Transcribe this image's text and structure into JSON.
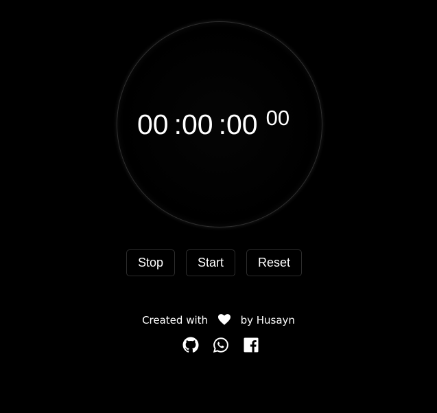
{
  "stopwatch": {
    "hours": "00",
    "minutes": ":00",
    "seconds": ":00",
    "milliseconds": "00"
  },
  "controls": {
    "stop_label": "Stop",
    "start_label": "Start",
    "reset_label": "Reset"
  },
  "footer": {
    "created_with": "Created with",
    "by_author": "by Husayn",
    "heart_icon": "heart-icon"
  },
  "social": {
    "icons": [
      "github-icon",
      "whatsapp-icon",
      "facebook-icon"
    ]
  },
  "colors": {
    "background": "#000000",
    "text": "#ffffff",
    "border": "#2d2d2d"
  }
}
